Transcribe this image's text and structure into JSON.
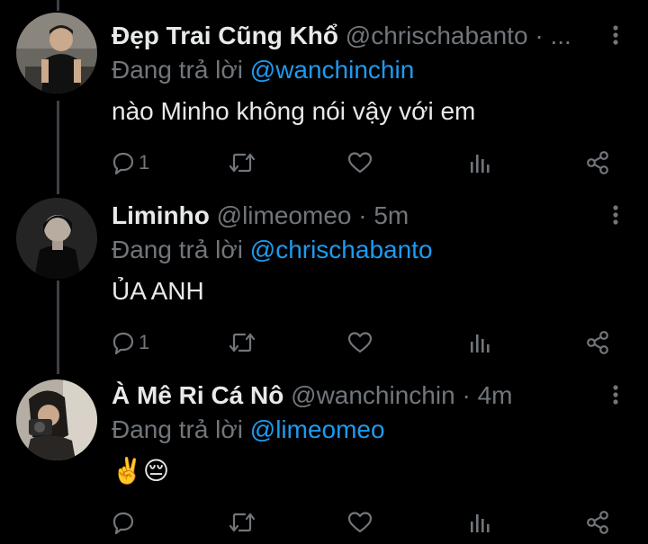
{
  "tweets": [
    {
      "name": "Đẹp Trai Cũng Khổ",
      "handle": "@chrischabanto",
      "separator": "·",
      "time": "...",
      "reply_label": "Đang trả lời",
      "reply_user": "@wanchinchin",
      "text": "nào Minho không nói vậy với em",
      "reply_count": "1"
    },
    {
      "name": "Liminho",
      "handle": "@limeomeo",
      "separator": "·",
      "time": "5m",
      "reply_label": "Đang trả lời",
      "reply_user": "@chrischabanto",
      "text": "ỦA ANH",
      "reply_count": "1"
    },
    {
      "name": "À Mê Ri Cá Nô",
      "handle": "@wanchinchin",
      "separator": "·",
      "time": "4m",
      "reply_label": "Đang trả lời",
      "reply_user": "@limeomeo",
      "text": "✌️😔",
      "reply_count": ""
    }
  ],
  "colors": {
    "background": "#000000",
    "text": "#e7e9ea",
    "muted": "#71767b",
    "link": "#1d9bf0",
    "thread_line": "#3d4147"
  },
  "icons": {
    "more": "more-vertical-icon",
    "reply": "reply-bubble-icon",
    "retweet": "retweet-icon",
    "like": "heart-icon",
    "stats": "stats-bars-icon",
    "share": "share-nodes-icon"
  }
}
